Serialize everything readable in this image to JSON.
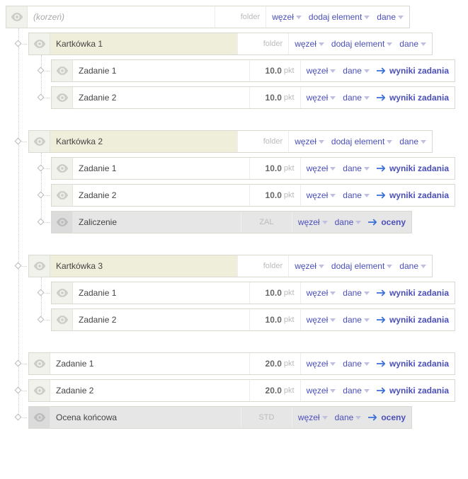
{
  "root": {
    "label": "(korzeń)",
    "meta": "folder"
  },
  "actions": {
    "wezel": "węzeł",
    "dodaj": "dodaj element",
    "dane": "dane",
    "wyniki": "wyniki zadania",
    "oceny": "oceny"
  },
  "units": {
    "pkt": "pkt"
  },
  "k1": {
    "label": "Kartkówka 1",
    "meta": "folder",
    "z1": {
      "label": "Zadanie 1",
      "pts": "10.0"
    },
    "z2": {
      "label": "Zadanie 2",
      "pts": "10.0"
    }
  },
  "k2": {
    "label": "Kartkówka 2",
    "meta": "folder",
    "z1": {
      "label": "Zadanie 1",
      "pts": "10.0"
    },
    "z2": {
      "label": "Zadanie 2",
      "pts": "10.0"
    },
    "zal": {
      "label": "Zaliczenie",
      "meta": "ZAL"
    }
  },
  "k3": {
    "label": "Kartkówka 3",
    "meta": "folder",
    "z1": {
      "label": "Zadanie 1",
      "pts": "10.0"
    },
    "z2": {
      "label": "Zadanie 2",
      "pts": "10.0"
    }
  },
  "top": {
    "z1": {
      "label": "Zadanie 1",
      "pts": "20.0"
    },
    "z2": {
      "label": "Zadanie 2",
      "pts": "20.0"
    },
    "final": {
      "label": "Ocena końcowa",
      "meta": "STD"
    }
  }
}
